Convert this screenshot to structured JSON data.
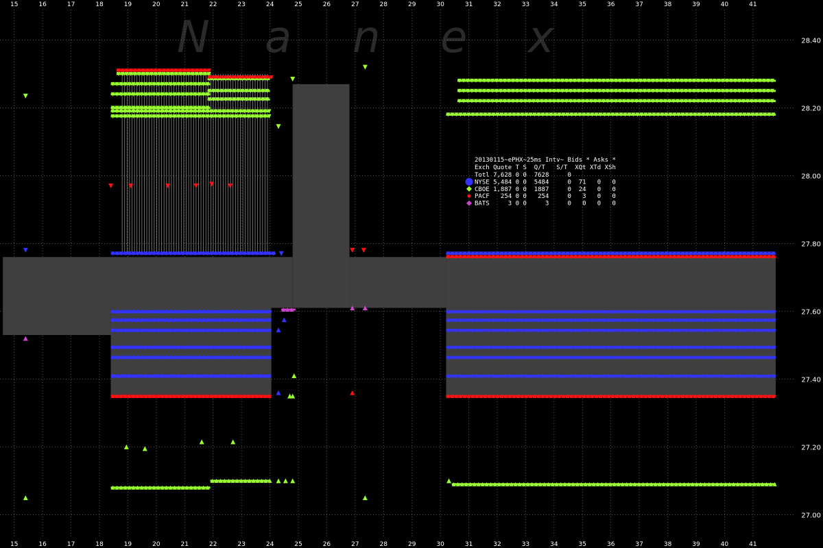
{
  "watermark": [
    "N",
    "a",
    "n",
    "e",
    "x"
  ],
  "chart_data": {
    "type": "scatter",
    "title": "20130115~ePHX~25ms Intv~ Bids * Asks *",
    "xlim": [
      14.5,
      42.5
    ],
    "ylim": [
      26.93,
      28.49
    ],
    "x_ticks": [
      "15",
      "16",
      "17",
      "18",
      "19",
      "20",
      "21",
      "22",
      "23",
      "24",
      "25",
      "26",
      "27",
      "28",
      "29",
      "30",
      "31",
      "32",
      "33",
      "34",
      "35",
      "36",
      "37",
      "38",
      "39",
      "40",
      "41"
    ],
    "y_ticks": [
      "28.40",
      "28.20",
      "28.00",
      "27.80",
      "27.60",
      "27.40",
      "27.20",
      "27.00"
    ],
    "colors": {
      "nyse": "#3333ff",
      "cboe": "#99ff33",
      "pacf": "#ff1111",
      "bats": "#cc44cc",
      "band": "#3f3f3f"
    },
    "nbbo_band": [
      {
        "x0": 14.6,
        "x1": 18.4,
        "y_low": 27.53,
        "y_high": 27.76
      },
      {
        "x0": 18.4,
        "x1": 24.8,
        "y_low": 27.61,
        "y_high": 27.76
      },
      {
        "x0": 24.8,
        "x1": 26.8,
        "y_low": 27.61,
        "y_high": 28.27
      },
      {
        "x0": 26.8,
        "x1": 30.2,
        "y_low": 27.61,
        "y_high": 27.76
      },
      {
        "x0": 30.2,
        "x1": 41.8,
        "y_low": 27.61,
        "y_high": 27.76
      }
    ],
    "quote_blocks": [
      {
        "x0": 18.4,
        "x1": 24.05,
        "y_low": 27.35,
        "y_high": 27.61
      },
      {
        "x0": 30.2,
        "x1": 41.8,
        "y_low": 27.35,
        "y_high": 27.61
      }
    ],
    "series": [
      {
        "name": "NYSE",
        "color": "#3333ff",
        "levels": [
          {
            "x0": 18.4,
            "x1": 24.2,
            "y": 27.77
          },
          {
            "x0": 30.2,
            "x1": 41.8,
            "y": 27.77
          },
          {
            "x0": 18.4,
            "x1": 24.05,
            "y": 27.6
          },
          {
            "x0": 18.4,
            "x1": 24.05,
            "y": 27.575
          },
          {
            "x0": 18.4,
            "x1": 24.05,
            "y": 27.545
          },
          {
            "x0": 18.4,
            "x1": 24.05,
            "y": 27.495
          },
          {
            "x0": 18.4,
            "x1": 24.05,
            "y": 27.465
          },
          {
            "x0": 18.4,
            "x1": 24.05,
            "y": 27.41
          },
          {
            "x0": 30.2,
            "x1": 41.8,
            "y": 27.6
          },
          {
            "x0": 30.2,
            "x1": 41.8,
            "y": 27.575
          },
          {
            "x0": 30.2,
            "x1": 41.8,
            "y": 27.545
          },
          {
            "x0": 30.2,
            "x1": 41.8,
            "y": 27.495
          },
          {
            "x0": 30.2,
            "x1": 41.8,
            "y": 27.465
          },
          {
            "x0": 30.2,
            "x1": 41.8,
            "y": 27.41
          }
        ]
      },
      {
        "name": "CBOE",
        "color": "#99ff33",
        "levels": [
          {
            "x0": 18.6,
            "x1": 21.9,
            "y": 28.3
          },
          {
            "x0": 18.4,
            "x1": 21.9,
            "y": 28.27
          },
          {
            "x0": 18.4,
            "x1": 21.9,
            "y": 28.24
          },
          {
            "x0": 18.4,
            "x1": 21.9,
            "y": 28.2
          },
          {
            "x0": 18.4,
            "x1": 24.0,
            "y": 28.19
          },
          {
            "x0": 18.4,
            "x1": 24.0,
            "y": 28.175
          },
          {
            "x0": 21.8,
            "x1": 24.0,
            "y": 28.285
          },
          {
            "x0": 21.8,
            "x1": 24.0,
            "y": 28.25
          },
          {
            "x0": 21.8,
            "x1": 24.0,
            "y": 28.225
          },
          {
            "x0": 30.6,
            "x1": 41.8,
            "y": 28.28
          },
          {
            "x0": 30.6,
            "x1": 41.8,
            "y": 28.25
          },
          {
            "x0": 30.6,
            "x1": 41.8,
            "y": 28.22
          },
          {
            "x0": 30.2,
            "x1": 41.8,
            "y": 28.18
          },
          {
            "x0": 18.4,
            "x1": 21.9,
            "y": 27.08
          },
          {
            "x0": 21.9,
            "x1": 24.0,
            "y": 27.1
          },
          {
            "x0": 30.4,
            "x1": 41.8,
            "y": 27.09
          }
        ]
      },
      {
        "name": "PACF",
        "color": "#ff1111",
        "levels": [
          {
            "x0": 18.6,
            "x1": 21.9,
            "y": 28.31
          },
          {
            "x0": 21.8,
            "x1": 24.1,
            "y": 28.29
          },
          {
            "x0": 18.4,
            "x1": 24.05,
            "y": 27.35
          },
          {
            "x0": 30.2,
            "x1": 41.8,
            "y": 27.35
          },
          {
            "x0": 30.2,
            "x1": 41.8,
            "y": 27.76
          }
        ]
      },
      {
        "name": "BATS",
        "color": "#cc44cc",
        "levels": [
          {
            "x0": 24.4,
            "x1": 24.9,
            "y": 27.605
          }
        ]
      }
    ],
    "points": [
      {
        "x": 15.4,
        "y": 28.235,
        "s": "CBOE"
      },
      {
        "x": 15.4,
        "y": 27.05,
        "s": "CBOE"
      },
      {
        "x": 15.4,
        "y": 27.52,
        "s": "BATS"
      },
      {
        "x": 15.4,
        "y": 27.78,
        "s": "NYSE"
      },
      {
        "x": 18.95,
        "y": 27.2,
        "s": "CBOE"
      },
      {
        "x": 19.6,
        "y": 27.195,
        "s": "CBOE"
      },
      {
        "x": 21.6,
        "y": 27.215,
        "s": "CBOE"
      },
      {
        "x": 22.7,
        "y": 27.215,
        "s": "CBOE"
      },
      {
        "x": 24.3,
        "y": 28.145,
        "s": "CBOE"
      },
      {
        "x": 24.8,
        "y": 28.285,
        "s": "CBOE"
      },
      {
        "x": 24.85,
        "y": 27.41,
        "s": "CBOE"
      },
      {
        "x": 24.7,
        "y": 27.35,
        "s": "CBOE"
      },
      {
        "x": 24.8,
        "y": 27.35,
        "s": "CBOE"
      },
      {
        "x": 24.3,
        "y": 27.1,
        "s": "CBOE"
      },
      {
        "x": 24.55,
        "y": 27.1,
        "s": "CBOE"
      },
      {
        "x": 24.8,
        "y": 27.1,
        "s": "CBOE"
      },
      {
        "x": 27.35,
        "y": 28.32,
        "s": "CBOE"
      },
      {
        "x": 27.35,
        "y": 27.05,
        "s": "CBOE"
      },
      {
        "x": 30.3,
        "y": 27.1,
        "s": "CBOE"
      },
      {
        "x": 18.4,
        "y": 27.97,
        "s": "PACF"
      },
      {
        "x": 19.1,
        "y": 27.97,
        "s": "PACF"
      },
      {
        "x": 20.4,
        "y": 27.97,
        "s": "PACF"
      },
      {
        "x": 21.4,
        "y": 27.97,
        "s": "PACF"
      },
      {
        "x": 21.95,
        "y": 27.975,
        "s": "PACF"
      },
      {
        "x": 22.6,
        "y": 27.97,
        "s": "PACF"
      },
      {
        "x": 26.9,
        "y": 27.36,
        "s": "PACF"
      },
      {
        "x": 27.3,
        "y": 27.78,
        "s": "PACF"
      },
      {
        "x": 26.9,
        "y": 27.78,
        "s": "PACF"
      },
      {
        "x": 26.9,
        "y": 27.61,
        "s": "BATS"
      },
      {
        "x": 27.35,
        "y": 27.61,
        "s": "BATS"
      },
      {
        "x": 24.3,
        "y": 27.545,
        "s": "NYSE"
      },
      {
        "x": 24.5,
        "y": 27.575,
        "s": "NYSE"
      },
      {
        "x": 24.3,
        "y": 27.36,
        "s": "NYSE"
      },
      {
        "x": 24.4,
        "y": 27.77,
        "s": "NYSE"
      }
    ],
    "trade_lines": {
      "x0": 18.8,
      "x1": 24.0,
      "y_low": 27.77,
      "y_high": 28.3,
      "count": 60
    },
    "legend": {
      "title": "20130115~ePHX~25ms Intv~ Bids * Asks *",
      "header": "Exch Quote T S  Q/T   S/T  XQt XTd XSh",
      "rows": [
        {
          "text": "Totl 7,628 0 0  7628     0",
          "marker": ""
        },
        {
          "text": "NYSE 5,484 0 0  5484     0  71   0   0",
          "marker": "#3333ff"
        },
        {
          "text": "CBOE 1,887 0 0  1887     0  24   0   0",
          "marker": "#99ff33"
        },
        {
          "text": "PACF   254 0 0   254     0   3   0   0",
          "marker": "#ff1111"
        },
        {
          "text": "BATS     3 0 0     3     0   0   0   0",
          "marker": "#cc44cc"
        }
      ]
    }
  }
}
